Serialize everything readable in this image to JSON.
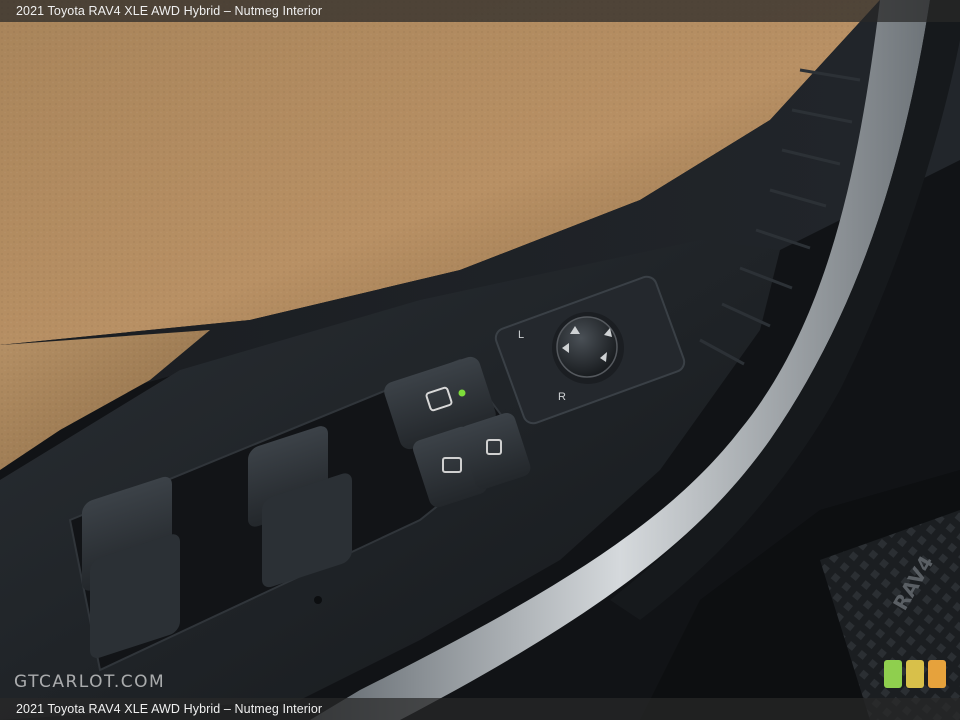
{
  "caption": {
    "top": "2021 Toyota RAV4 XLE AWD Hybrid – Nutmeg Interior",
    "bottom": "2021 Toyota RAV4 XLE AWD Hybrid – Nutmeg Interior"
  },
  "watermark": {
    "text": "GTCARLOT.COM"
  },
  "mirror_control": {
    "left_label": "L",
    "right_label": "R"
  },
  "embossed_text": "RAV4",
  "colors": {
    "leather": "#b08a5c",
    "panel": "#1d2125",
    "chrome": "#9aa0a5",
    "indicator": "#7ddc3a",
    "logo_blocks": [
      "#8fcf4e",
      "#d8c04a",
      "#e6a23c"
    ]
  }
}
